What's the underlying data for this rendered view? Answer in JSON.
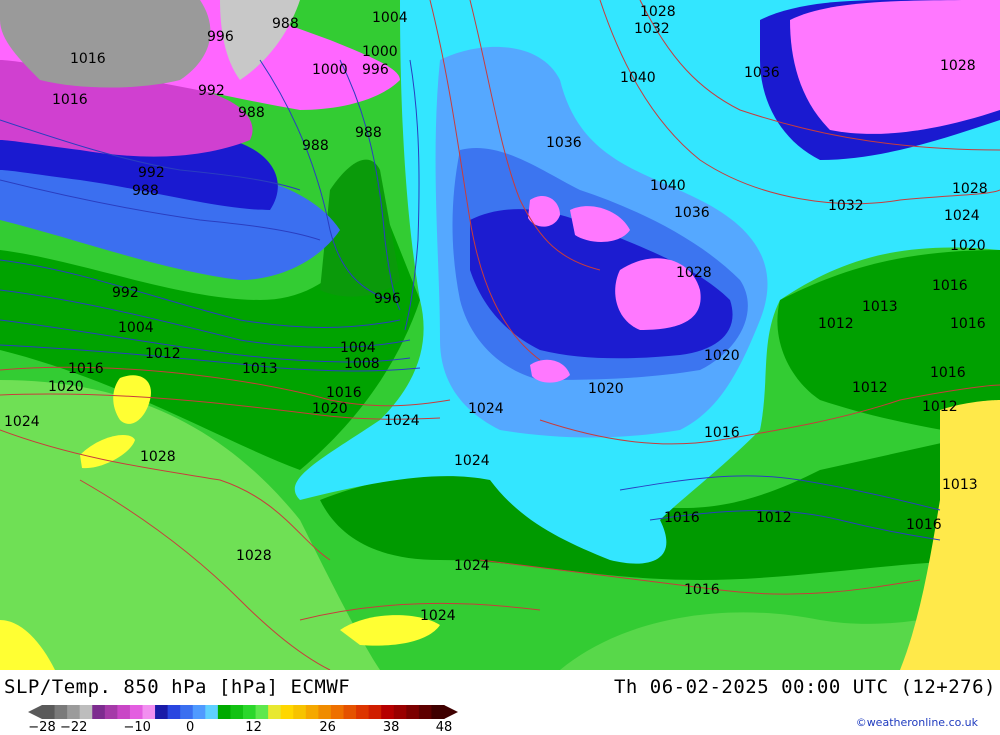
{
  "header": {
    "title_left": "SLP/Temp. 850 hPa [hPa] ECMWF",
    "title_right": "Th 06-02-2025 00:00 UTC (12+276)"
  },
  "colorbar": {
    "tick_labels": [
      "-28",
      "-22",
      "-10",
      "0",
      "12",
      "26",
      "38",
      "48"
    ],
    "tick_values": [
      -28,
      -22,
      -10,
      0,
      12,
      26,
      38,
      48
    ],
    "min": -28,
    "max": 48,
    "colors": [
      "#5a5a5a",
      "#7a7a7a",
      "#9b9b9b",
      "#bdbdbd",
      "#7d2c8f",
      "#a53aa8",
      "#c946c6",
      "#e35ee0",
      "#f28ff0",
      "#1a1aa8",
      "#2a46e0",
      "#3a6ff0",
      "#4f9aff",
      "#5fd0ff",
      "#00aa00",
      "#13c213",
      "#2bd72b",
      "#5fe84d",
      "#e8e830",
      "#ffd700",
      "#f7c300",
      "#f5a800",
      "#f08c00",
      "#ee7000",
      "#e55200",
      "#dd3500",
      "#d01e00",
      "#b60000",
      "#9a0000",
      "#7c0000",
      "#5e0000",
      "#3f0000"
    ]
  },
  "credit": "©weatheronline.co.uk",
  "map": {
    "colors": {
      "very_cold": "#ff78ff",
      "cold_violet": "#e040e0",
      "dark_blue": "#1a1ad0",
      "mid_blue": "#3f7bf2",
      "light_blue": "#55aaff",
      "cyan": "#33e6ff",
      "dark_green": "#00a000",
      "green": "#22c822",
      "light_green": "#66e04a",
      "yellow": "#ffff33",
      "grey": "#a0a0a0",
      "isobar_red": "#d04040",
      "isobar_blue": "#2040c0"
    },
    "isobar_labels": [
      "1016",
      "996",
      "988",
      "1004",
      "1000",
      "996",
      "1000",
      "1016",
      "1012",
      "992",
      "988",
      "988",
      "988",
      "992",
      "988",
      "1028",
      "1032",
      "1040",
      "1036",
      "1028",
      "1036",
      "1040",
      "1036",
      "1032",
      "1028",
      "1024",
      "1020",
      "1028",
      "992",
      "996",
      "1004",
      "1008",
      "1004",
      "1012",
      "1013",
      "1016",
      "1016",
      "1020",
      "1020",
      "1024",
      "1024",
      "1028",
      "1024",
      "1020",
      "1016",
      "1016",
      "1012",
      "1016",
      "1012",
      "1013",
      "1016",
      "1012",
      "1016",
      "1012",
      "1013",
      "1016",
      "1016",
      "1020",
      "1024",
      "1024",
      "1028",
      "1024",
      "1024",
      "1024",
      "1016"
    ]
  }
}
